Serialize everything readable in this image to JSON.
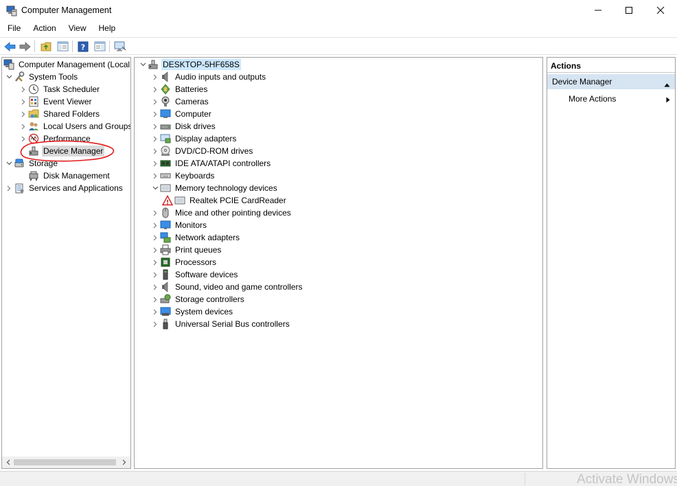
{
  "window": {
    "title": "Computer Management",
    "controls": [
      "minimize",
      "maximize",
      "close"
    ]
  },
  "menu": [
    "File",
    "Action",
    "View",
    "Help"
  ],
  "toolbar": {
    "buttons": [
      "back-arrow-icon",
      "forward-arrow-icon",
      "up-folder-icon",
      "show-hide-tree-icon",
      "help-icon",
      "show-hide-action-pane-icon",
      "monitor-icon"
    ]
  },
  "left_tree": {
    "root": "Computer Management (Local",
    "system_tools": "System Tools",
    "task_scheduler": "Task Scheduler",
    "event_viewer": "Event Viewer",
    "shared_folders": "Shared Folders",
    "local_users": "Local Users and Groups",
    "performance": "Performance",
    "device_manager": "Device Manager",
    "storage": "Storage",
    "disk_management": "Disk Management",
    "services": "Services and Applications"
  },
  "device_tree": {
    "root": "DESKTOP-5HF658S",
    "items": [
      "Audio inputs and outputs",
      "Batteries",
      "Cameras",
      "Computer",
      "Disk drives",
      "Display adapters",
      "DVD/CD-ROM drives",
      "IDE ATA/ATAPI controllers",
      "Keyboards",
      "Memory technology devices",
      "Realtek PCIE CardReader",
      "Mice and other pointing devices",
      "Monitors",
      "Network adapters",
      "Print queues",
      "Processors",
      "Software devices",
      "Sound, video and game controllers",
      "Storage controllers",
      "System devices",
      "Universal Serial Bus controllers"
    ]
  },
  "actions": {
    "header": "Actions",
    "section": "Device Manager",
    "more_actions": "More Actions"
  },
  "watermark": "Activate Windows",
  "colors": {
    "selection_gray": "#d9d9d9",
    "selection_blue": "#cce8ff",
    "action_section_bg": "#d6e4f2",
    "annotation_red": "#e01b1b",
    "warning_red": "#d02020"
  }
}
